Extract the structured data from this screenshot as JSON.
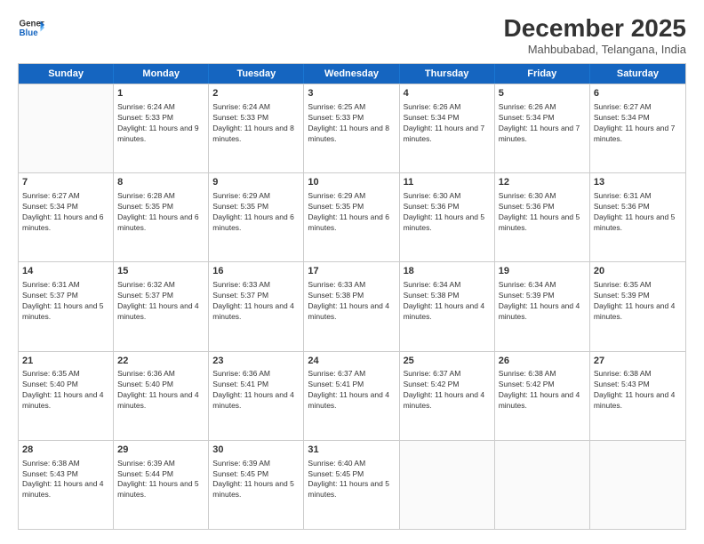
{
  "logo": {
    "line1": "General",
    "line2": "Blue"
  },
  "title": "December 2025",
  "subtitle": "Mahbubabad, Telangana, India",
  "weekdays": [
    "Sunday",
    "Monday",
    "Tuesday",
    "Wednesday",
    "Thursday",
    "Friday",
    "Saturday"
  ],
  "rows": [
    [
      {
        "day": "",
        "empty": true
      },
      {
        "day": "1",
        "sunrise": "6:24 AM",
        "sunset": "5:33 PM",
        "daylight": "11 hours and 9 minutes."
      },
      {
        "day": "2",
        "sunrise": "6:24 AM",
        "sunset": "5:33 PM",
        "daylight": "11 hours and 8 minutes."
      },
      {
        "day": "3",
        "sunrise": "6:25 AM",
        "sunset": "5:33 PM",
        "daylight": "11 hours and 8 minutes."
      },
      {
        "day": "4",
        "sunrise": "6:26 AM",
        "sunset": "5:34 PM",
        "daylight": "11 hours and 7 minutes."
      },
      {
        "day": "5",
        "sunrise": "6:26 AM",
        "sunset": "5:34 PM",
        "daylight": "11 hours and 7 minutes."
      },
      {
        "day": "6",
        "sunrise": "6:27 AM",
        "sunset": "5:34 PM",
        "daylight": "11 hours and 7 minutes."
      }
    ],
    [
      {
        "day": "7",
        "sunrise": "6:27 AM",
        "sunset": "5:34 PM",
        "daylight": "11 hours and 6 minutes."
      },
      {
        "day": "8",
        "sunrise": "6:28 AM",
        "sunset": "5:35 PM",
        "daylight": "11 hours and 6 minutes."
      },
      {
        "day": "9",
        "sunrise": "6:29 AM",
        "sunset": "5:35 PM",
        "daylight": "11 hours and 6 minutes."
      },
      {
        "day": "10",
        "sunrise": "6:29 AM",
        "sunset": "5:35 PM",
        "daylight": "11 hours and 6 minutes."
      },
      {
        "day": "11",
        "sunrise": "6:30 AM",
        "sunset": "5:36 PM",
        "daylight": "11 hours and 5 minutes."
      },
      {
        "day": "12",
        "sunrise": "6:30 AM",
        "sunset": "5:36 PM",
        "daylight": "11 hours and 5 minutes."
      },
      {
        "day": "13",
        "sunrise": "6:31 AM",
        "sunset": "5:36 PM",
        "daylight": "11 hours and 5 minutes."
      }
    ],
    [
      {
        "day": "14",
        "sunrise": "6:31 AM",
        "sunset": "5:37 PM",
        "daylight": "11 hours and 5 minutes."
      },
      {
        "day": "15",
        "sunrise": "6:32 AM",
        "sunset": "5:37 PM",
        "daylight": "11 hours and 4 minutes."
      },
      {
        "day": "16",
        "sunrise": "6:33 AM",
        "sunset": "5:37 PM",
        "daylight": "11 hours and 4 minutes."
      },
      {
        "day": "17",
        "sunrise": "6:33 AM",
        "sunset": "5:38 PM",
        "daylight": "11 hours and 4 minutes."
      },
      {
        "day": "18",
        "sunrise": "6:34 AM",
        "sunset": "5:38 PM",
        "daylight": "11 hours and 4 minutes."
      },
      {
        "day": "19",
        "sunrise": "6:34 AM",
        "sunset": "5:39 PM",
        "daylight": "11 hours and 4 minutes."
      },
      {
        "day": "20",
        "sunrise": "6:35 AM",
        "sunset": "5:39 PM",
        "daylight": "11 hours and 4 minutes."
      }
    ],
    [
      {
        "day": "21",
        "sunrise": "6:35 AM",
        "sunset": "5:40 PM",
        "daylight": "11 hours and 4 minutes."
      },
      {
        "day": "22",
        "sunrise": "6:36 AM",
        "sunset": "5:40 PM",
        "daylight": "11 hours and 4 minutes."
      },
      {
        "day": "23",
        "sunrise": "6:36 AM",
        "sunset": "5:41 PM",
        "daylight": "11 hours and 4 minutes."
      },
      {
        "day": "24",
        "sunrise": "6:37 AM",
        "sunset": "5:41 PM",
        "daylight": "11 hours and 4 minutes."
      },
      {
        "day": "25",
        "sunrise": "6:37 AM",
        "sunset": "5:42 PM",
        "daylight": "11 hours and 4 minutes."
      },
      {
        "day": "26",
        "sunrise": "6:38 AM",
        "sunset": "5:42 PM",
        "daylight": "11 hours and 4 minutes."
      },
      {
        "day": "27",
        "sunrise": "6:38 AM",
        "sunset": "5:43 PM",
        "daylight": "11 hours and 4 minutes."
      }
    ],
    [
      {
        "day": "28",
        "sunrise": "6:38 AM",
        "sunset": "5:43 PM",
        "daylight": "11 hours and 4 minutes."
      },
      {
        "day": "29",
        "sunrise": "6:39 AM",
        "sunset": "5:44 PM",
        "daylight": "11 hours and 5 minutes."
      },
      {
        "day": "30",
        "sunrise": "6:39 AM",
        "sunset": "5:45 PM",
        "daylight": "11 hours and 5 minutes."
      },
      {
        "day": "31",
        "sunrise": "6:40 AM",
        "sunset": "5:45 PM",
        "daylight": "11 hours and 5 minutes."
      },
      {
        "day": "",
        "empty": true
      },
      {
        "day": "",
        "empty": true
      },
      {
        "day": "",
        "empty": true
      }
    ]
  ]
}
